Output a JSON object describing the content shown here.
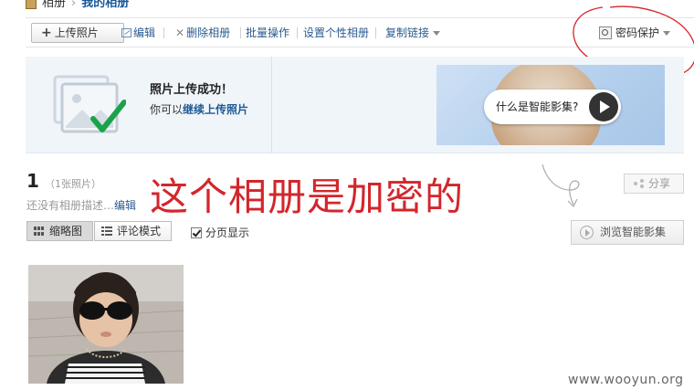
{
  "breadcrumb": {
    "root": "相册",
    "current": "我的相册",
    "separator": "›"
  },
  "toolbar": {
    "upload_label": "上传照片",
    "edit_label": "编辑",
    "delete_label": "删除相册",
    "batch_label": "批量操作",
    "custom_label": "设置个性相册",
    "copy_link_label": "复制链接",
    "password_label": "密码保护"
  },
  "success": {
    "title": "照片上传成功！",
    "prefix": "你可以",
    "continue_link": "继续上传照片"
  },
  "promo": {
    "button_label": "什么是智能影集?"
  },
  "album": {
    "count": "1",
    "count_detail": "（1张照片）",
    "description": "还没有相册描述…",
    "edit_link": "编辑"
  },
  "annotation": "这个相册是加密的",
  "share_label": "分享",
  "view_modes": {
    "thumbnail": "缩略图",
    "comment": "评论模式"
  },
  "paging_label": "分页显示",
  "slideshow_label": "浏览智能影集",
  "watermark": "www.wooyun.org",
  "colors": {
    "annotation_red": "#d3262b",
    "link_blue": "#2a5b8f",
    "panel_bg": "#f0f5fa",
    "check_green": "#1aa34a"
  }
}
